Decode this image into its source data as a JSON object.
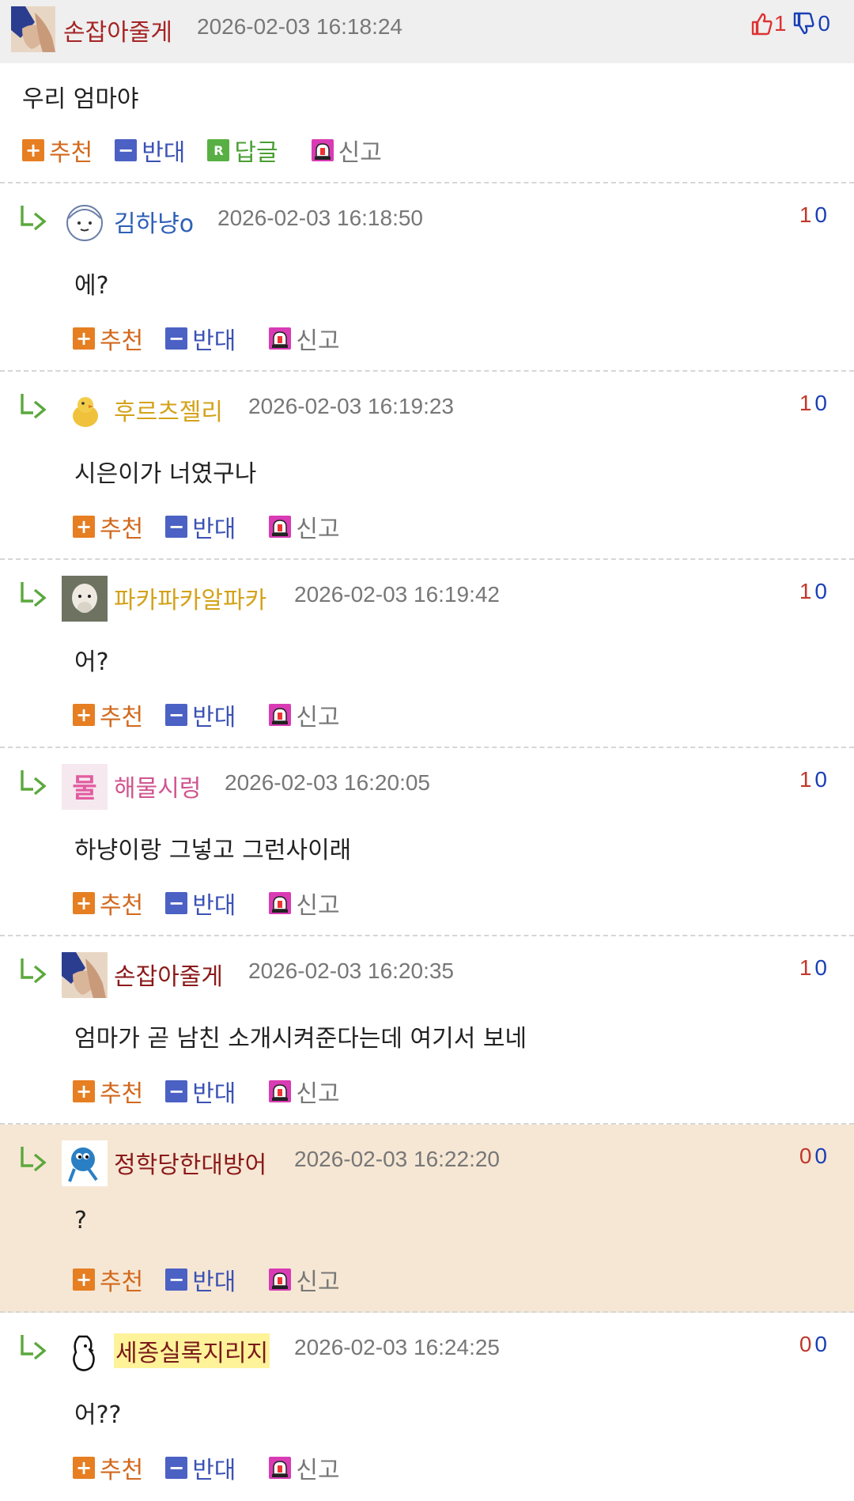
{
  "parent": {
    "nickname": "손잡아줄게",
    "date": "2026-02-03 16:18:24",
    "up": "1",
    "down": "0",
    "text": "우리 엄마야",
    "actions": {
      "recommend": "추천",
      "oppose": "반대",
      "reply": "답글",
      "report": "신고"
    }
  },
  "reply_actions": {
    "recommend": "추천",
    "oppose": "반대",
    "report": "신고"
  },
  "replies": [
    {
      "nickname": "김하냥o",
      "nick_color": "#2d5fb8",
      "date": "2026-02-03 16:18:50",
      "up": "1",
      "down": "0",
      "text": "에?",
      "avatar": "face-icon"
    },
    {
      "nickname": "후르츠젤리",
      "nick_color": "#d4a21a",
      "date": "2026-02-03 16:19:23",
      "up": "1",
      "down": "0",
      "text": "시은이가 너였구나",
      "avatar": "chick-icon"
    },
    {
      "nickname": "파카파카알파카",
      "nick_color": "#d4a21a",
      "date": "2026-02-03 16:19:42",
      "up": "1",
      "down": "0",
      "text": "어?",
      "avatar": "alpaca-icon"
    },
    {
      "nickname": "해물시렁",
      "nick_color": "#d0558f",
      "date": "2026-02-03 16:20:05",
      "up": "1",
      "down": "0",
      "text": "하냥이랑 그넣고 그런사이래",
      "avatar": "sticker-icon"
    },
    {
      "nickname": "손잡아줄게",
      "nick_color": "#8b1a1a",
      "date": "2026-02-03 16:20:35",
      "up": "1",
      "down": "0",
      "text": "엄마가 곧 남친 소개시켜준다는데 여기서 보네",
      "avatar": "hands-icon"
    },
    {
      "nickname": "정학당한대방어",
      "nick_color": "#8b1a1a",
      "date": "2026-02-03 16:22:20",
      "up": "0",
      "down": "0",
      "text": "?",
      "avatar": "fish-icon",
      "highlight": true
    },
    {
      "nickname": "세종실록지리지",
      "nick_color": "#7a1a1a",
      "date": "2026-02-03 16:24:25",
      "up": "0",
      "down": "0",
      "text": "어??",
      "avatar": "doodle-icon",
      "nick_bg": "#fff39a"
    }
  ],
  "colors": {
    "header_bg": "#efefef",
    "highlight_bg": "#f6e7d4",
    "up": "#c0392b",
    "down": "#1a3fb5"
  }
}
